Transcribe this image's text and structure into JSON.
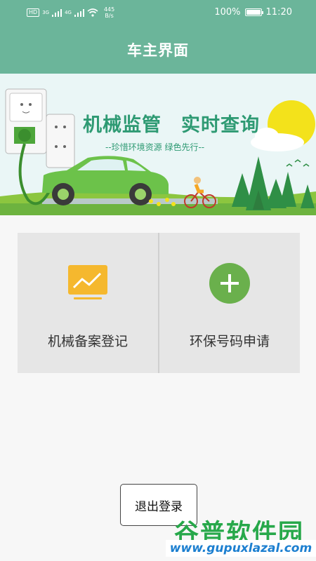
{
  "status_bar": {
    "hd_badge": "HD",
    "net1": "3G",
    "net2": "4G",
    "speed_value": "445",
    "speed_unit": "B/s",
    "battery_percent": "100%",
    "time": "11:20"
  },
  "header": {
    "title": "车主界面"
  },
  "banner": {
    "headline": "机械监管　实时查询",
    "slogan": "--珍惜环境资源 绿色先行--"
  },
  "tiles": [
    {
      "label": "机械备案登记",
      "icon": "chart-monitor-icon",
      "icon_color": "#f5b82e"
    },
    {
      "label": "环保号码申请",
      "icon": "plus-circle-icon",
      "icon_color": "#6ab04c"
    }
  ],
  "logout": {
    "label": "退出登录"
  },
  "watermark": {
    "text": "谷普软件园",
    "url": "www.gupuxlazal.com"
  },
  "colors": {
    "header": "#6bb59a",
    "accent_green": "#2e9a73",
    "tile_bg": "#e6e6e6"
  }
}
